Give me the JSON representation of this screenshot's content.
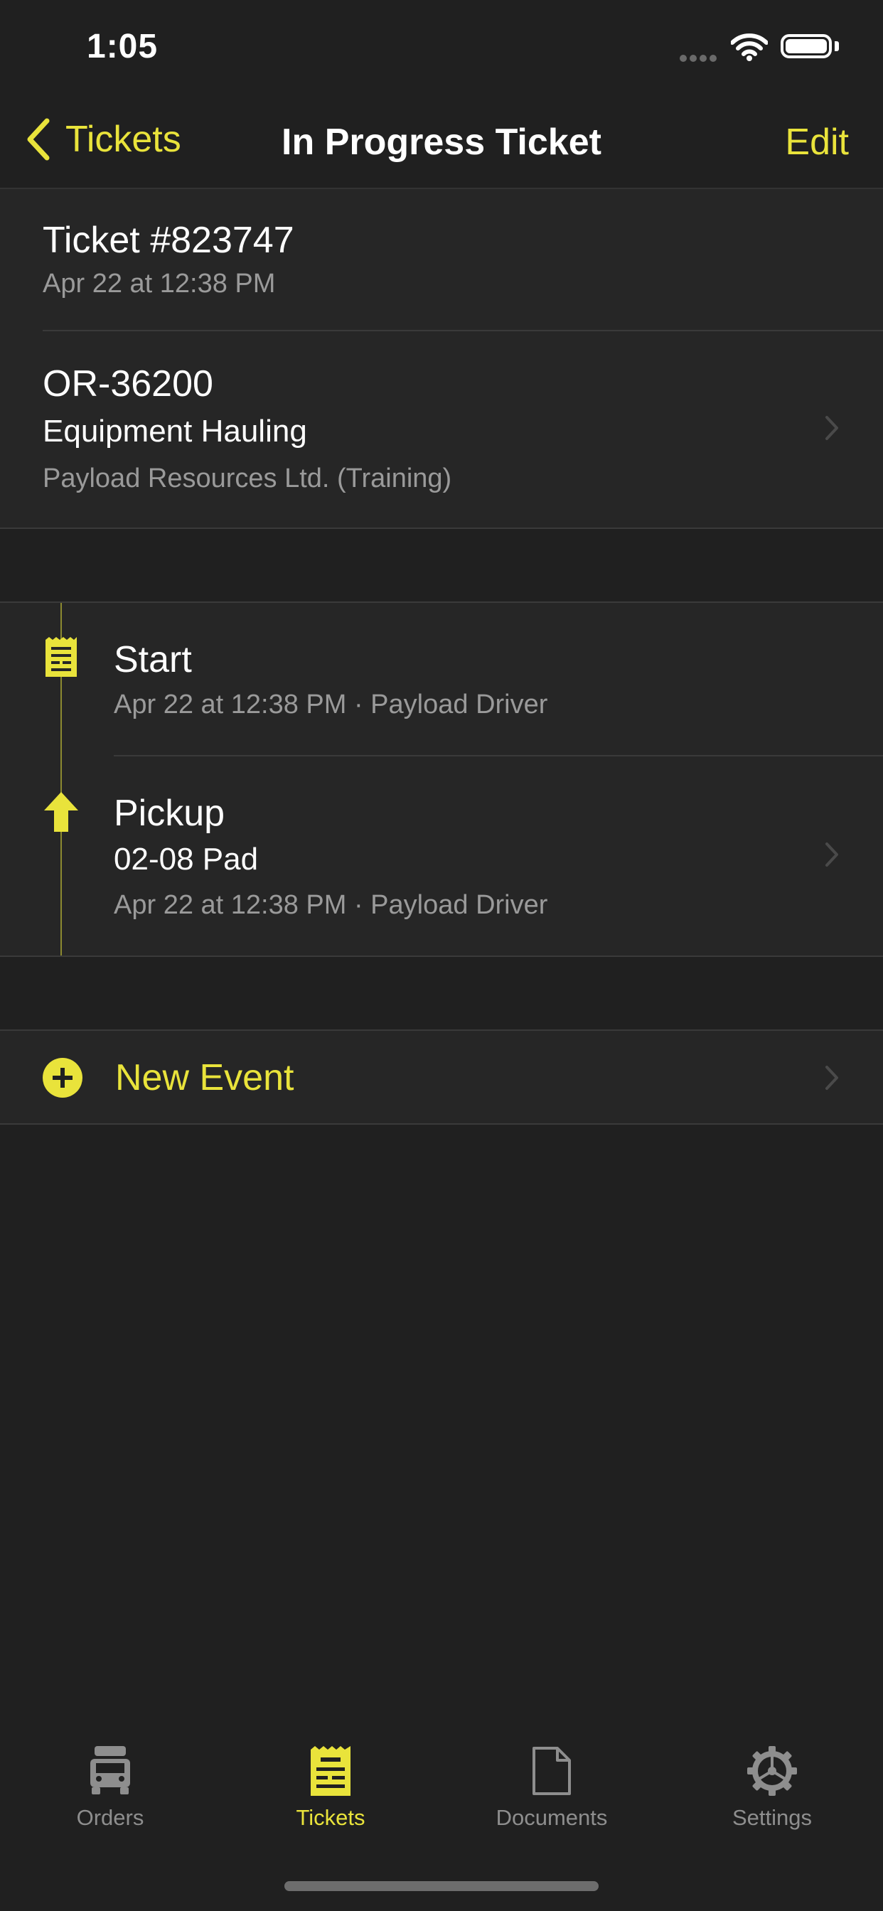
{
  "status_bar": {
    "time": "1:05"
  },
  "nav": {
    "back_label": "Tickets",
    "title": "In Progress Ticket",
    "edit_label": "Edit"
  },
  "ticket": {
    "number": "Ticket #823747",
    "date": "Apr 22 at 12:38 PM"
  },
  "order": {
    "id": "OR-36200",
    "service": "Equipment Hauling",
    "company": "Payload Resources Ltd. (Training)"
  },
  "events": [
    {
      "name": "Start",
      "detail": "Apr 22 at 12:38 PM · Payload Driver",
      "icon": "ticket-icon"
    },
    {
      "name": "Pickup",
      "location": "02-08 Pad",
      "detail": "Apr 22 at 12:38 PM · Payload Driver",
      "icon": "arrow-up-icon"
    }
  ],
  "new_event": {
    "label": "New Event"
  },
  "tabs": [
    {
      "label": "Orders",
      "icon": "truck-icon"
    },
    {
      "label": "Tickets",
      "icon": "ticket-icon",
      "active": true
    },
    {
      "label": "Documents",
      "icon": "document-icon"
    },
    {
      "label": "Settings",
      "icon": "gear-icon"
    }
  ],
  "colors": {
    "accent": "#e9e33b",
    "background": "#202020",
    "cell": "#262626",
    "secondary_text": "#9a9a9a"
  }
}
